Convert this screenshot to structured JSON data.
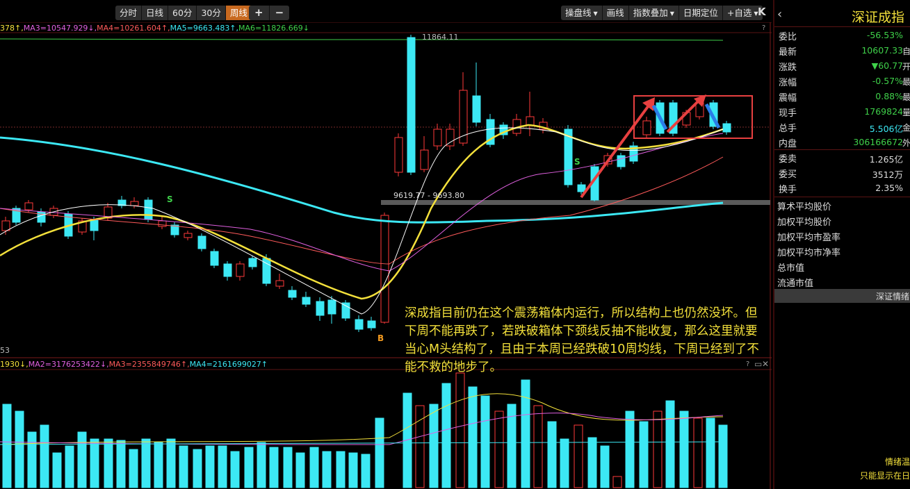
{
  "toolbar": {
    "periods": [
      "分时",
      "日线",
      "60分",
      "30分",
      "周线"
    ],
    "active_period": "周线",
    "zoom_in": "+",
    "zoom_out": "−",
    "right_buttons": [
      "操盘线",
      "画线",
      "指数叠加",
      "日期定位",
      "+自选"
    ],
    "collapse": "K"
  },
  "ma_legend": [
    {
      "text": "378↑,",
      "color": "#f3e03b"
    },
    {
      "text": "MA3=10547.929↓,",
      "color": "#e060e0"
    },
    {
      "text": "MA4=10261.604↑,",
      "color": "#ff5a5a"
    },
    {
      "text": "MA5=9663.483↑,",
      "color": "#3ce8f4"
    },
    {
      "text": "MA6=11826.669↓",
      "color": "#3fd14a"
    }
  ],
  "vol_legend": [
    {
      "text": "1930↓,",
      "color": "#f3e03b"
    },
    {
      "text": "MA2=3176253422↓,",
      "color": "#e060e0"
    },
    {
      "text": "MA3=2355849746↑,",
      "color": "#ff5a5a"
    },
    {
      "text": "MA4=2161699027↑",
      "color": "#3ce8f4"
    }
  ],
  "price_labels": {
    "high": "11864.11",
    "range": "9619.77 - 9693.80",
    "left_axis_low": "53"
  },
  "signals": {
    "sell1": "S",
    "sell2": "S",
    "buy": "B"
  },
  "annotation": "深成指目前仍在这个震荡箱体内运行，所以结构上也仍然没坏。但下周不能再跌了，若跌破箱体下颈线反抽不能收复，那么这里就要当心M头结构了，且由于本周已经跌破10周均线，下周已经到了不能不救的地步了。",
  "panel": {
    "title": "深证成指",
    "rows": [
      {
        "k": "委比",
        "v": "-56.53%",
        "c": "#3fd14a",
        "e": ""
      },
      {
        "k": "最新",
        "v": "10607.33",
        "c": "#3fd14a",
        "e": "自"
      },
      {
        "k": "涨跌",
        "v": "▼60.77",
        "c": "#3fd14a",
        "e": "开"
      },
      {
        "k": "涨幅",
        "v": "-0.57%",
        "c": "#3fd14a",
        "e": "最"
      },
      {
        "k": "震幅",
        "v": "0.88%",
        "c": "#3fd14a",
        "e": "最"
      },
      {
        "k": "现手",
        "v": "1769824",
        "c": "#3fd14a",
        "e": "量"
      },
      {
        "k": "总手",
        "v": "5.506亿",
        "c": "#3ce8f4",
        "e": "金"
      },
      {
        "k": "内盘",
        "v": "306166672",
        "c": "#3fd14a",
        "e": "外"
      }
    ],
    "rows2": [
      {
        "k": "委卖",
        "v": "1.265亿",
        "c": "#ddd",
        "e": ""
      },
      {
        "k": "委买",
        "v": "3512万",
        "c": "#ddd",
        "e": ""
      },
      {
        "k": "换手",
        "v": "2.35%",
        "c": "#ddd",
        "e": ""
      }
    ],
    "extra": [
      "算术平均股价",
      "加权平均股价",
      "加权平均市盈率",
      "加权平均市净率",
      "总市值",
      "流通市值"
    ],
    "bar_label": "深证情绪",
    "foot1": "情绪温",
    "foot2": "只能显示在日"
  },
  "chart_data": {
    "type": "candlestick",
    "period": "weekly",
    "high_label": 11864.11,
    "range_label": [
      9619.77,
      9693.8
    ],
    "moving_averages": [
      "MA3",
      "MA4",
      "MA5",
      "MA6"
    ],
    "last_close": 10607.33
  }
}
